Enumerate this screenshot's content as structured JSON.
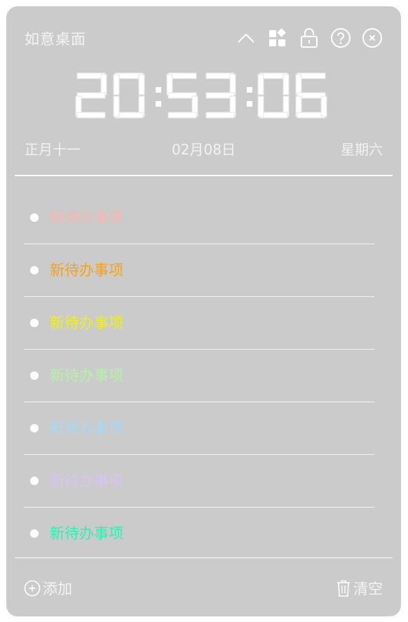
{
  "app": {
    "title": "如意桌面"
  },
  "toolbar": {
    "icons": [
      "collapse-icon",
      "widgets-icon",
      "lock-icon",
      "help-icon",
      "close-icon"
    ]
  },
  "clock": {
    "time": "20:53:06"
  },
  "date": {
    "lunar": "正月十一",
    "solar": "02月08日",
    "weekday": "星期六"
  },
  "todos": [
    {
      "text": "新待办事项",
      "color": "#f3b8b2"
    },
    {
      "text": "新待办事项",
      "color": "#f4a21a"
    },
    {
      "text": "新待办事项",
      "color": "#eef01a"
    },
    {
      "text": "新待办事项",
      "color": "#b4f3a6"
    },
    {
      "text": "新待办事项",
      "color": "#a9d8f4"
    },
    {
      "text": "新待办事项",
      "color": "#d9c3f1"
    },
    {
      "text": "新待办事项",
      "color": "#26f2b4"
    }
  ],
  "footer": {
    "add_label": "添加",
    "clear_label": "清空"
  },
  "colors": {
    "background": "#cbcbcb",
    "foreground": "#ffffff"
  }
}
